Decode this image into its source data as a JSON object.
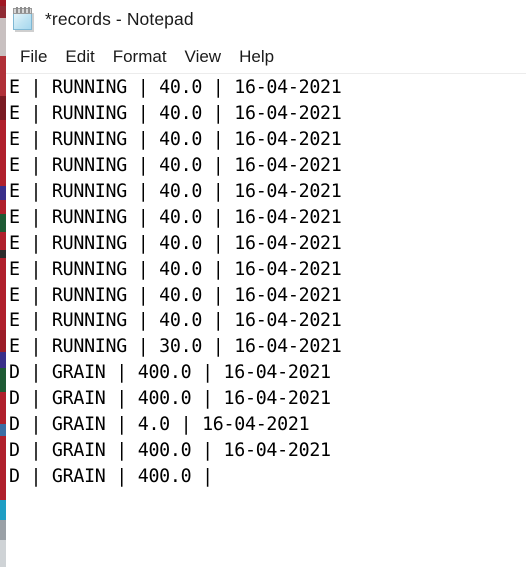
{
  "window": {
    "title": "*records - Notepad",
    "icon": "notepad-icon",
    "modified": true,
    "document_name": "records",
    "app_name": "Notepad"
  },
  "menu": {
    "items": [
      {
        "label": "File"
      },
      {
        "label": "Edit"
      },
      {
        "label": "Format"
      },
      {
        "label": "View"
      },
      {
        "label": "Help"
      }
    ]
  },
  "editor": {
    "font": "Consolas-like monospace",
    "wrap": false,
    "lines": [
      "E | RUNNING | 40.0 | 16-04-2021",
      "E | RUNNING | 40.0 | 16-04-2021",
      "E | RUNNING | 40.0 | 16-04-2021",
      "E | RUNNING | 40.0 | 16-04-2021",
      "E | RUNNING | 40.0 | 16-04-2021",
      "E | RUNNING | 40.0 | 16-04-2021",
      "E | RUNNING | 40.0 | 16-04-2021",
      "E | RUNNING | 40.0 | 16-04-2021",
      "E | RUNNING | 40.0 | 16-04-2021",
      "E | RUNNING | 40.0 | 16-04-2021",
      "E | RUNNING | 30.0 | 16-04-2021",
      "D | GRAIN | 400.0 | 16-04-2021",
      "D | GRAIN | 400.0 | 16-04-2021",
      "D | GRAIN | 4.0 | 16-04-2021",
      "D | GRAIN | 400.0 | 16-04-2021",
      "D | GRAIN | 400.0 |"
    ],
    "line_count": 16
  },
  "colors": {
    "window_background": "#ffffff",
    "text": "#000000",
    "title_text": "#1a1a1a",
    "menu_separator": "#ececec",
    "edge_strip_primary": "#b0202c"
  }
}
